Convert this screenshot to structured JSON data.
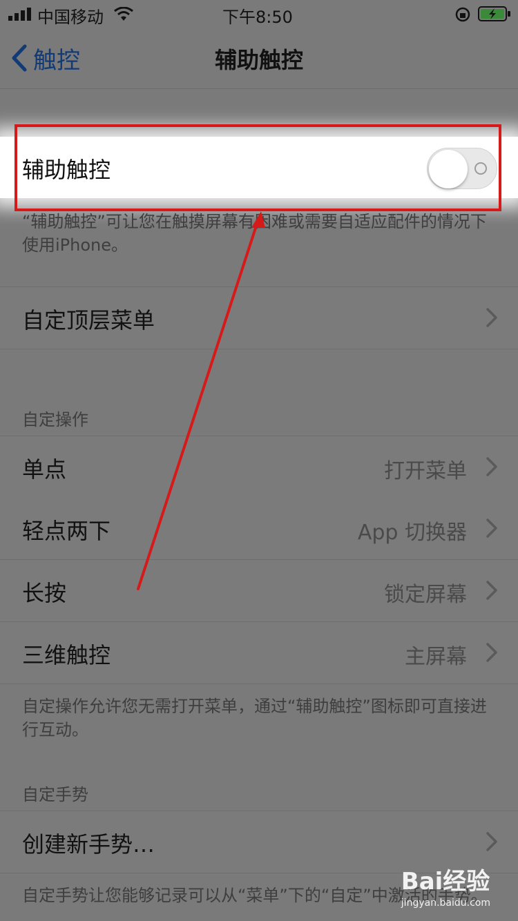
{
  "status_bar": {
    "carrier": "中国移动",
    "time": "下午8:50",
    "icons": [
      "signal-icon",
      "wifi-icon",
      "orientation-lock-icon",
      "battery-charging-icon"
    ]
  },
  "nav": {
    "back_label": "触控",
    "title": "辅助触控"
  },
  "assistive_touch": {
    "label": "辅助触控",
    "toggle_on": false,
    "description": "“辅助触控”可让您在触摸屏幕有困难或需要自适应配件的情况下使用iPhone。"
  },
  "top_menu": {
    "label": "自定顶层菜单"
  },
  "custom_actions": {
    "header": "自定操作",
    "rows": [
      {
        "label": "单点",
        "value": "打开菜单"
      },
      {
        "label": "轻点两下",
        "value": "App 切换器"
      },
      {
        "label": "长按",
        "value": "锁定屏幕"
      },
      {
        "label": "三维触控",
        "value": "主屏幕"
      }
    ],
    "footer": "自定操作允许您无需打开菜单，通过“辅助触控”图标即可直接进行互动。"
  },
  "custom_gestures": {
    "header": "自定手势",
    "create_label": "创建新手势…",
    "footer": "自定手势让您能够记录可以从“菜单”下的“自定”中激活的手势。"
  },
  "watermark": {
    "brand": "Bai经验",
    "url": "jingyan.baidu.com"
  },
  "colors": {
    "annotation_red": "#d61a1a",
    "link_blue": "#123a75"
  }
}
